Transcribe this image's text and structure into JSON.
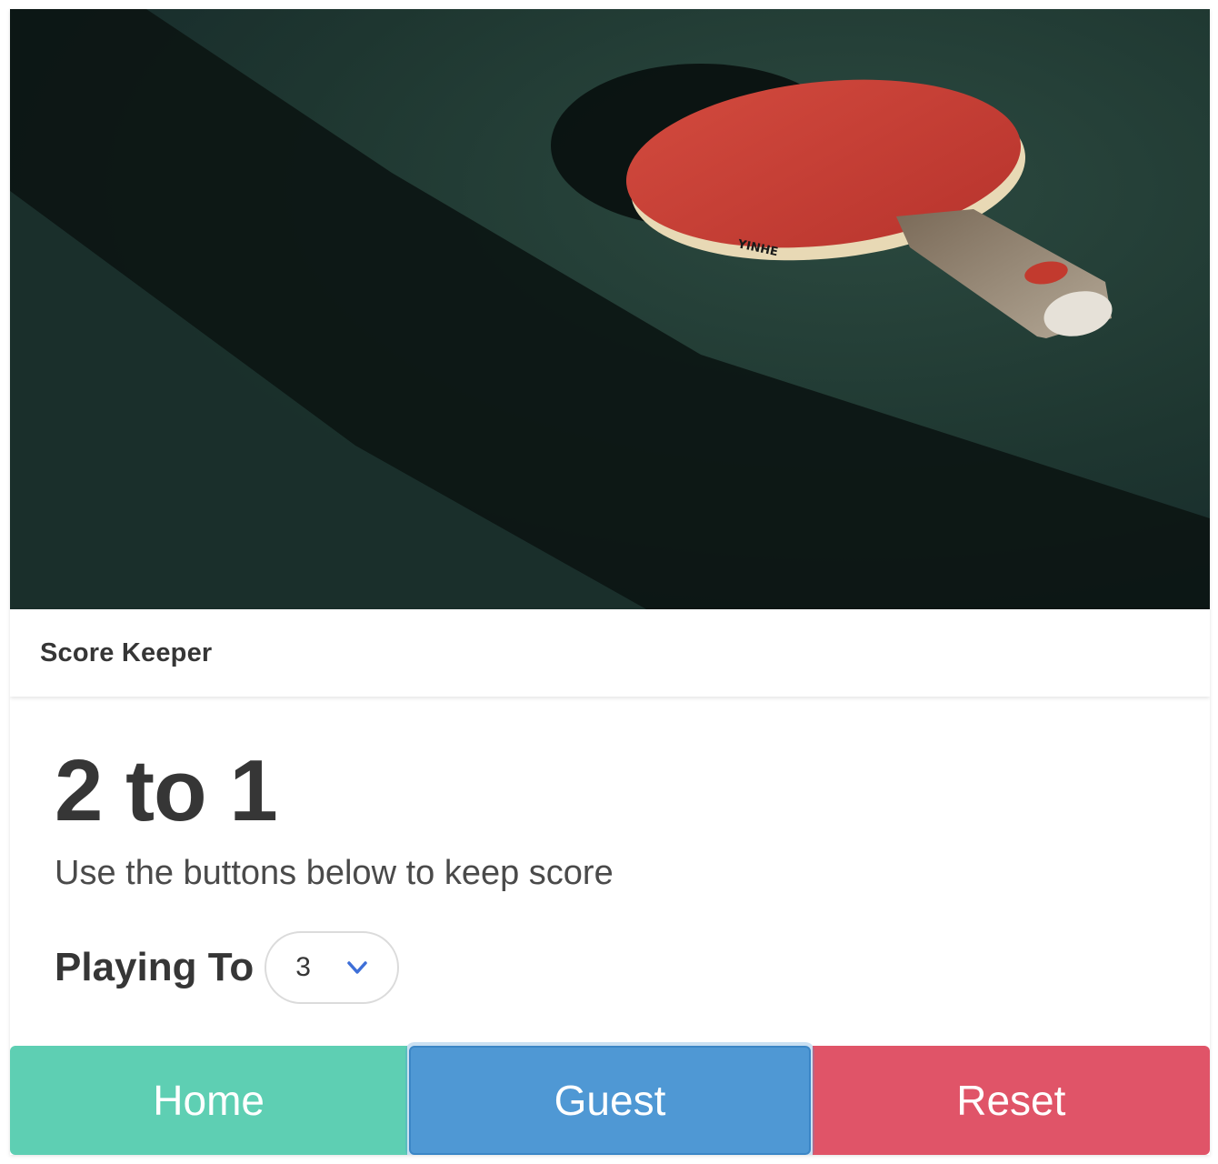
{
  "header": {
    "title": "Score Keeper"
  },
  "score": {
    "display": "2 to 1",
    "home": 2,
    "guest": 1
  },
  "subtitle": "Use the buttons below to keep score",
  "playing_to": {
    "label": "Playing To",
    "selected": "3"
  },
  "buttons": {
    "home": "Home",
    "guest": "Guest",
    "reset": "Reset"
  },
  "colors": {
    "home": "#5ecfb3",
    "guest": "#4f98d4",
    "reset": "#e05468",
    "select_arrow": "#3e6fd8"
  },
  "icons": {
    "select": "chevron-down-icon",
    "hero": "ping-pong-paddle-photo"
  }
}
